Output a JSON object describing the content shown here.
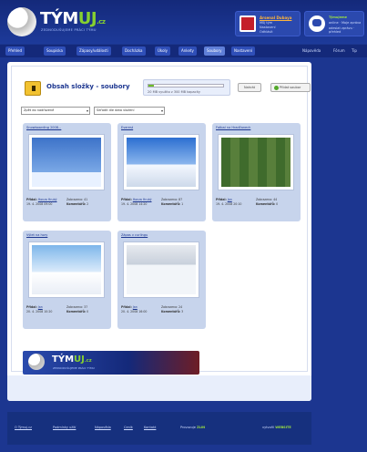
{
  "header": {
    "logo_title_main": "TÝM",
    "logo_title_accent": "UJ",
    "logo_tld": ".cz",
    "logo_sub": "ZEDNODUŠUJEME PRÁCI TÝMU",
    "user": {
      "name": "Arsenal Dubaya",
      "lines": [
        "Můj tým",
        "Nastavení",
        "Odhlásit"
      ]
    },
    "chat": {
      "title": "Týmujeme",
      "lines": [
        "online · Moje zpráva",
        "odeslat zprávu · přehled"
      ]
    }
  },
  "nav": {
    "items": [
      "Přehled",
      "Soupiska",
      "Zápasy/události",
      "Docházka",
      "Úkoly",
      "Ankety",
      "Soubory",
      "Nastavení"
    ],
    "active_index": 6,
    "right": [
      "Nápověda",
      "Fórum",
      "Tip"
    ]
  },
  "main": {
    "title": "Obsah složky - soubory",
    "upload": {
      "progress": 0.07,
      "text": "20 MB využito z 300 MB kapacity"
    },
    "upload_button": "Nahrát",
    "add_button": "Přidat soubor",
    "select_1": "Zpět do nadřazené",
    "select_2": "Seřadit dle data vložení"
  },
  "cards": [
    {
      "title": "Snowboarding 2008...",
      "added_by_label": "Přidal:",
      "added_by": "Honza Hrubý",
      "date": "19. 4. 2008 09:00",
      "views_label": "Zobrazeno:",
      "views": "41",
      "comments_label": "Komentářů:",
      "comments": "2"
    },
    {
      "title": "Everest",
      "added_by_label": "Přidal:",
      "added_by": "Honza Hrubý",
      "date": "19. 4. 2008 14:20",
      "views_label": "Zobrazeno:",
      "views": "87",
      "comments_label": "Komentářů:",
      "comments": "1"
    },
    {
      "title": "Fotbal na Hradčanech",
      "added_by_label": "Přidal:",
      "added_by": "Jan",
      "date": "19. 4. 2008 20:10",
      "views_label": "Zobrazeno:",
      "views": "44",
      "comments_label": "Komentářů:",
      "comments": "0"
    },
    {
      "title": "Výlet na hory",
      "added_by_label": "Přidal:",
      "added_by": "Jan",
      "date": "20. 4. 2008 10:20",
      "views_label": "Zobrazeno:",
      "views": "37",
      "comments_label": "Komentářů:",
      "comments": "0"
    },
    {
      "title": "Zápas v curlingu",
      "added_by_label": "Přidal:",
      "added_by": "Jan",
      "date": "20. 4. 2008 16:00",
      "views_label": "Zobrazeno:",
      "views": "24",
      "comments_label": "Komentářů:",
      "comments": "3"
    }
  ],
  "banner": {
    "title_main": "TÝM",
    "title_accent": "UJ",
    "tld": ".cz",
    "sub": "ZEDNODUŠUJEME PRÁCI TÝMU"
  },
  "footer": {
    "links": [
      "O Týmuj.cz",
      "Podmínky užití",
      "Nápověda",
      "Ceník",
      "Kontakt"
    ],
    "powered_label": "Provozuje",
    "powered_by": "ZLIN",
    "author_label": "vytvořil",
    "author": "WEBSITE"
  }
}
